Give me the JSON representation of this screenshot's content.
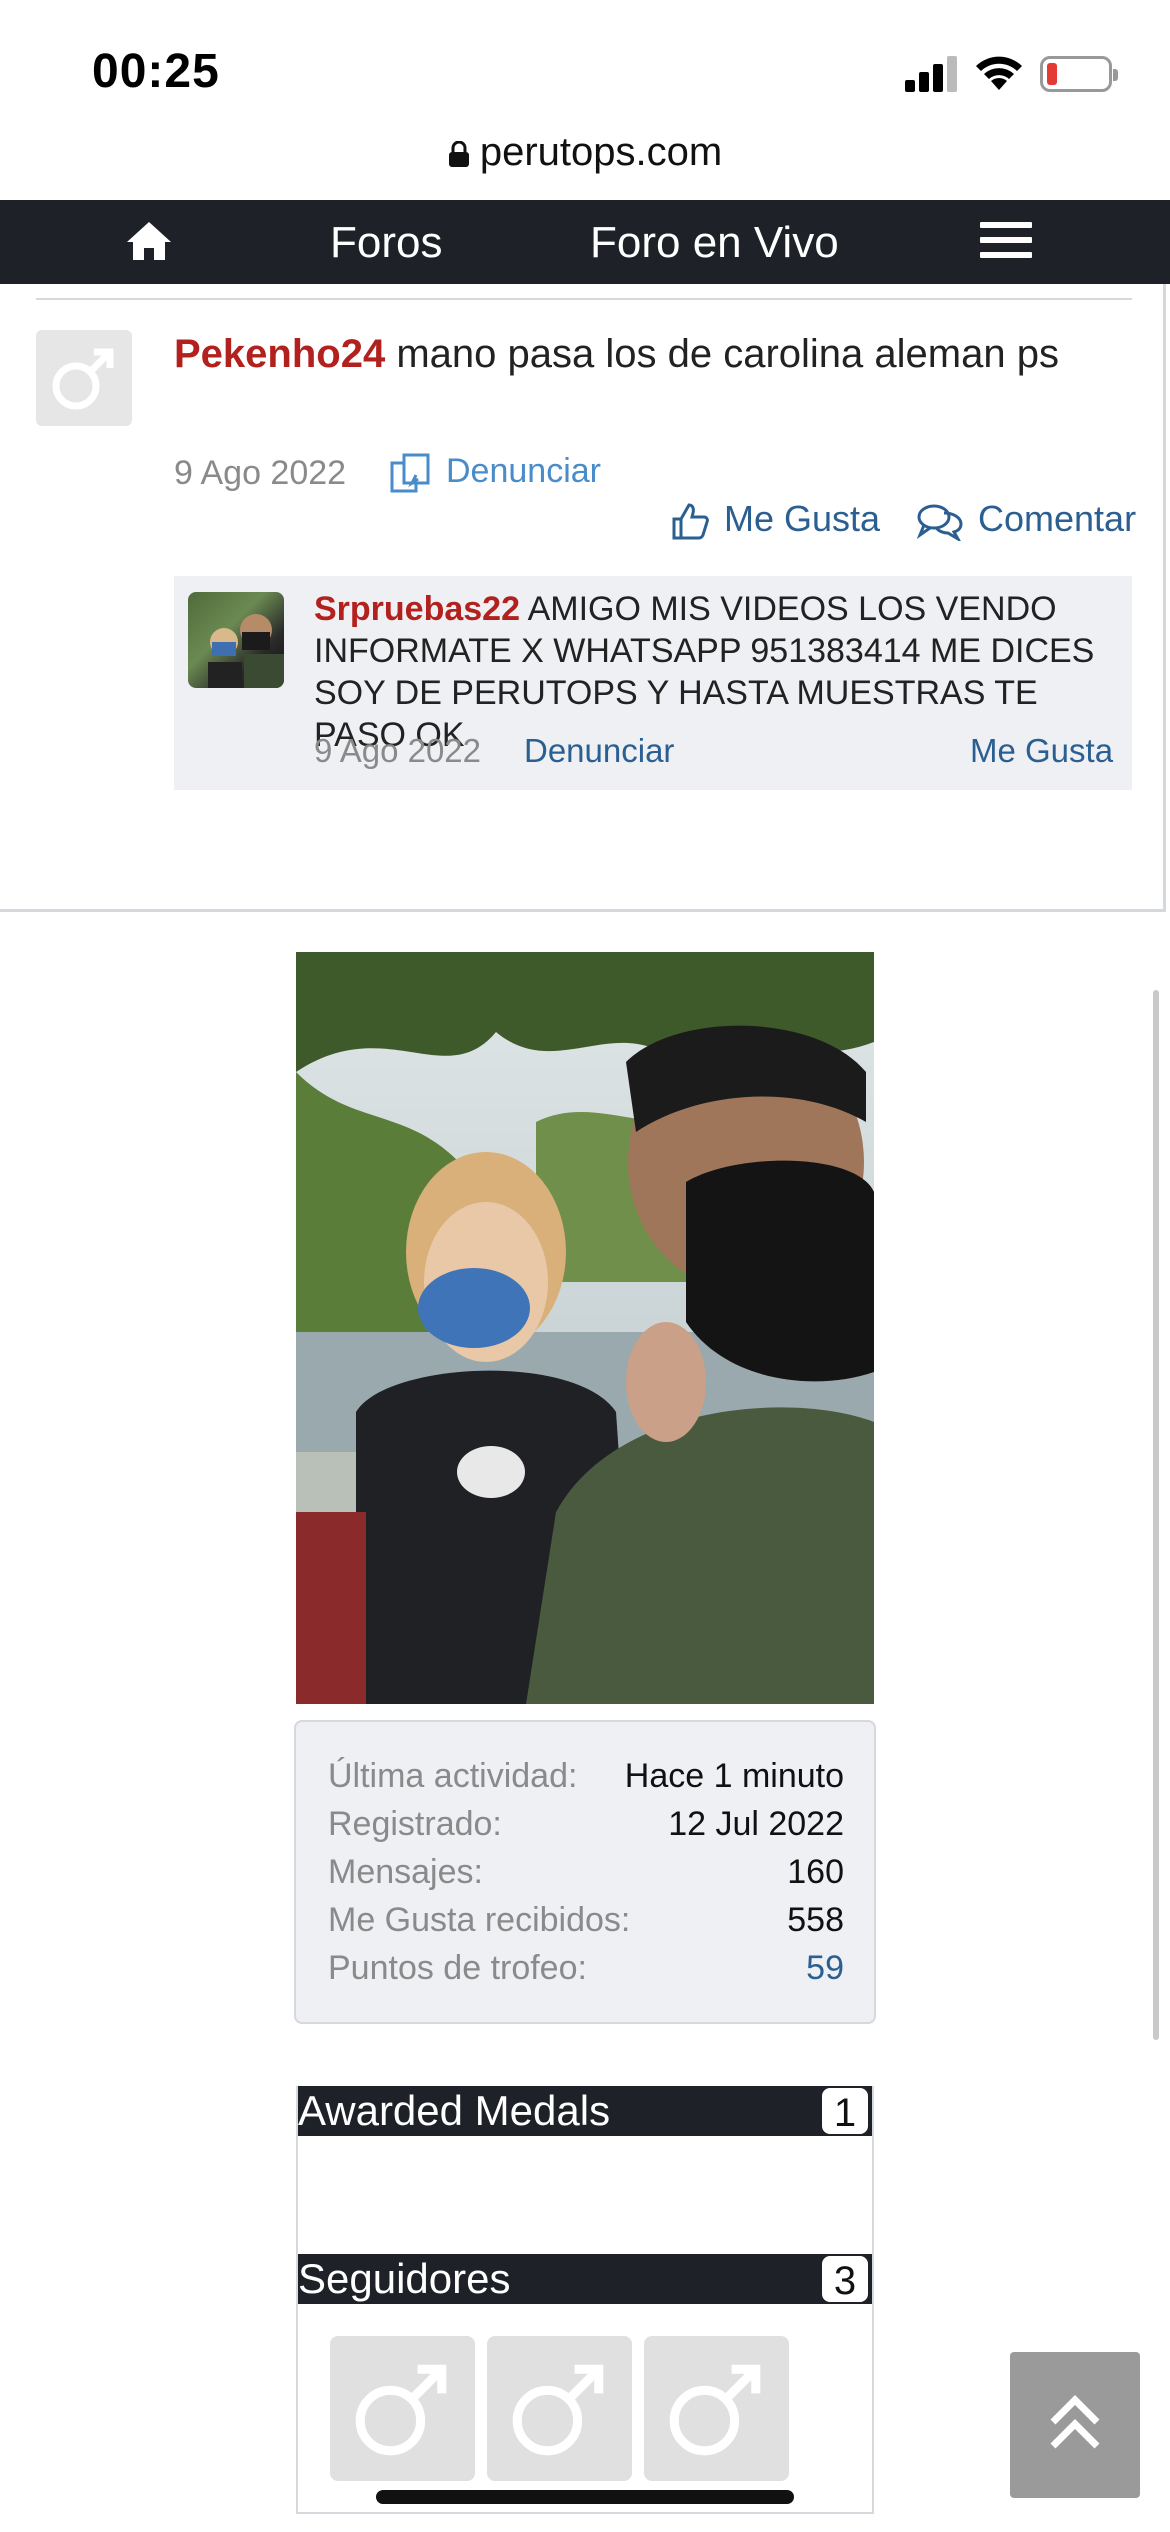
{
  "status_bar": {
    "time": "00:25",
    "url": "perutops.com"
  },
  "nav": {
    "home_icon": "home-icon",
    "items": [
      "Foros",
      "Foro en Vivo"
    ],
    "menu_icon": "hamburger-menu-icon"
  },
  "comment": {
    "username": "Pekenho24",
    "text": " mano pasa los de carolina aleman ps",
    "date": "9 Ago 2022",
    "report_label": "Denunciar",
    "like_label": "Me Gusta",
    "comment_label": "Comentar",
    "reply": {
      "username": "Srpruebas22",
      "text": " AMIGO MIS VIDEOS LOS VENDO INFORMATE X WHATSAPP 951383414 ME DICES SOY DE PERUTOPS Y HASTA MUESTRAS TE PASO OK",
      "date": "9 Ago 2022",
      "report_label": "Denunciar",
      "like_label": "Me Gusta"
    }
  },
  "profile": {
    "stats": [
      {
        "label": "Última actividad:",
        "value": "Hace 1 minuto"
      },
      {
        "label": "Registrado:",
        "value": "12 Jul 2022"
      },
      {
        "label": "Mensajes:",
        "value": "160"
      },
      {
        "label": "Me Gusta recibidos:",
        "value": "558"
      },
      {
        "label": "Puntos de trofeo:",
        "value": "59"
      }
    ]
  },
  "widgets": {
    "medals": {
      "title": "Awarded Medals",
      "count": "1"
    },
    "followers": {
      "title": "Seguidores",
      "count": "3"
    }
  },
  "colors": {
    "navbar": "#1e2228",
    "username": "#b3211e",
    "link": "#2c5f91",
    "report": "#4a8cc9"
  }
}
